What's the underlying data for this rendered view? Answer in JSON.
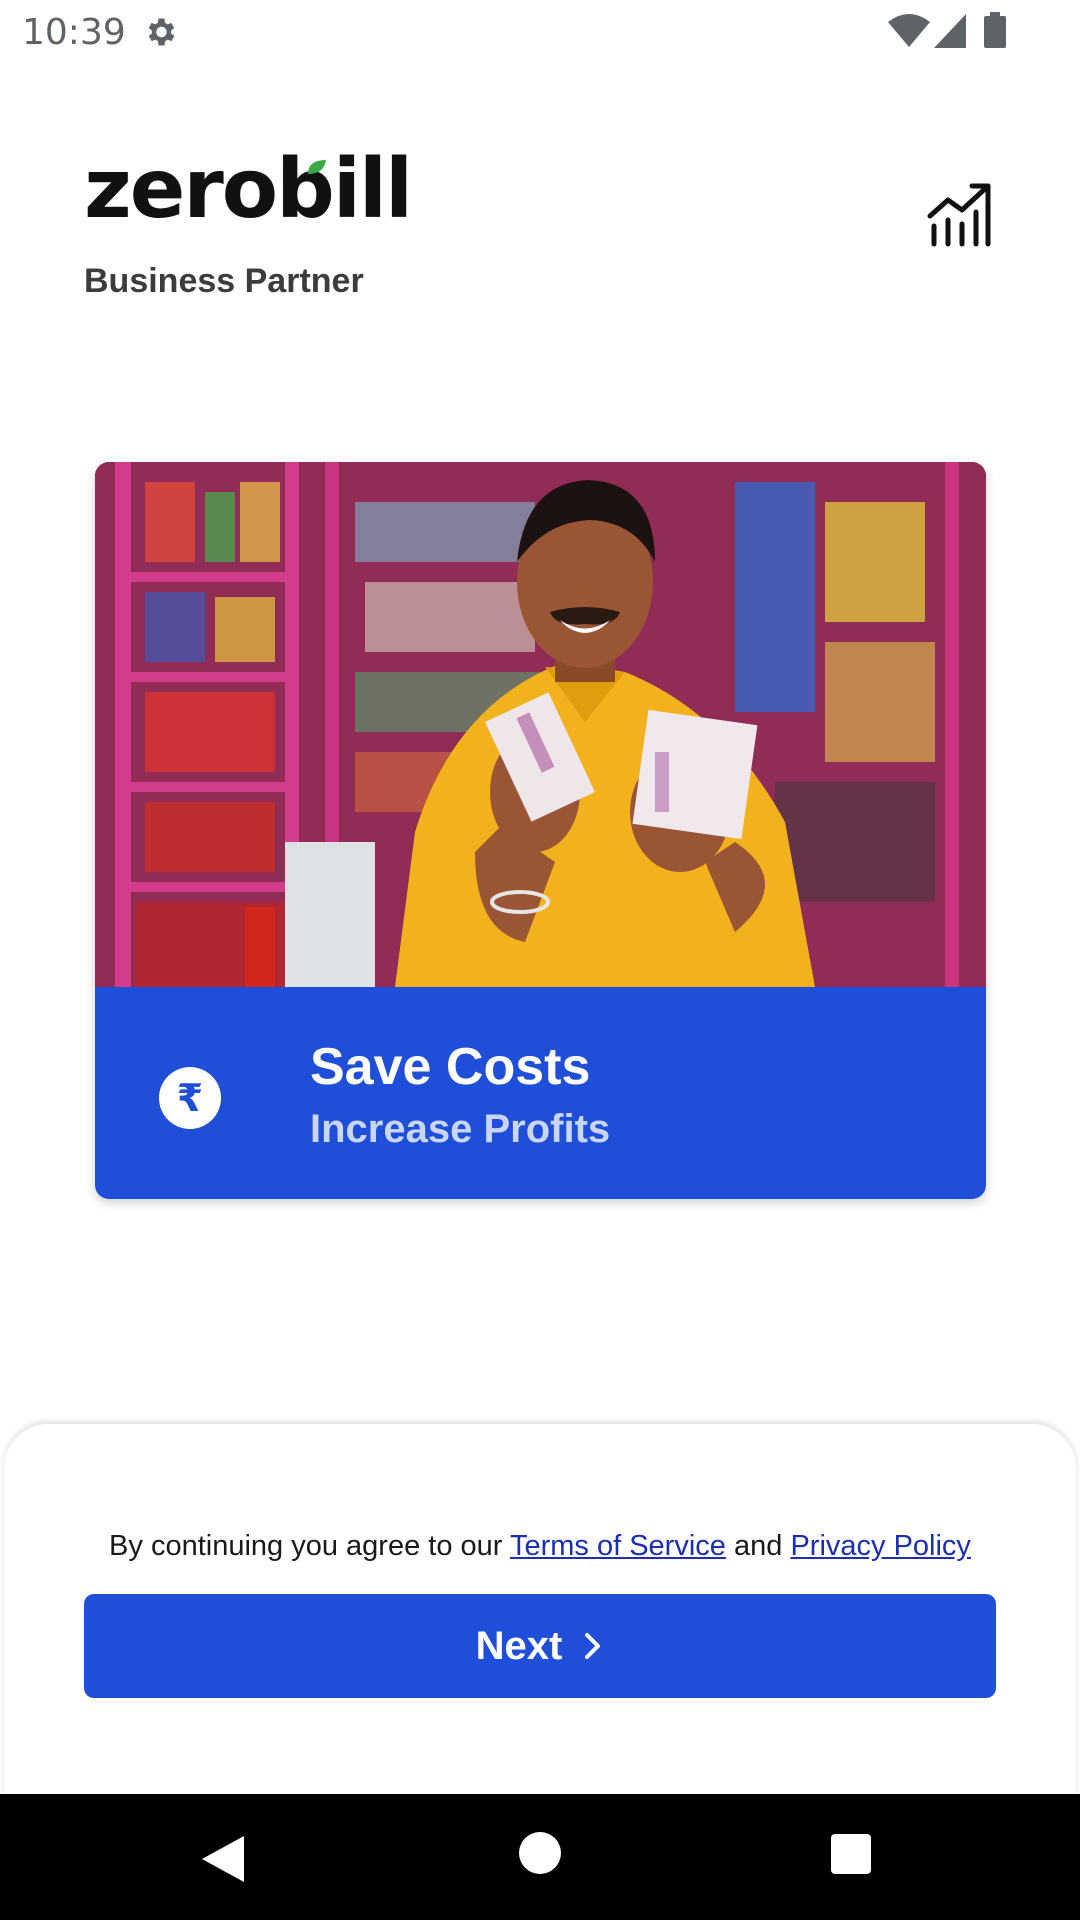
{
  "status_bar": {
    "time": "10:39",
    "icons": [
      "gear-icon",
      "wifi-icon",
      "signal-icon",
      "battery-icon"
    ]
  },
  "header": {
    "logo_text": "zerobill",
    "subtitle": "Business Partner",
    "icon": "chart-growth-icon"
  },
  "card": {
    "title": "Save Costs",
    "subtitle": "Increase Profits",
    "badge_symbol": "₹",
    "band_color": "#1f4fd8"
  },
  "legal": {
    "prefix": "By continuing you agree to our",
    "terms_link": "Terms of Service",
    "conjunction": "and",
    "privacy_link": "Privacy Policy"
  },
  "actions": {
    "next_label": "Next"
  },
  "colors": {
    "accent": "#1f4fd8",
    "link": "#1b2fb0",
    "leaf": "#3aa845"
  },
  "nav_bar": {
    "icons": [
      "back-icon",
      "home-icon",
      "recents-icon"
    ]
  }
}
